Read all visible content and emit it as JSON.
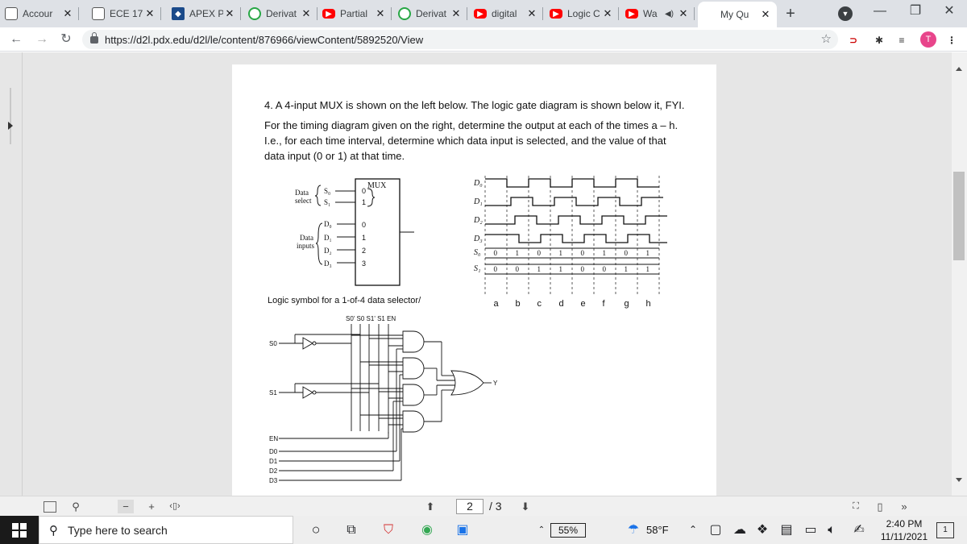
{
  "tabs": [
    {
      "label": "Accour",
      "icon": "d2l-icon"
    },
    {
      "label": "ECE 17",
      "icon": "d2l-icon"
    },
    {
      "label": "APEX P",
      "icon": "apex-icon"
    },
    {
      "label": "Derivat",
      "icon": "chegg-icon"
    },
    {
      "label": "Partial",
      "icon": "youtube-icon"
    },
    {
      "label": "Derivat",
      "icon": "chegg-icon"
    },
    {
      "label": "digital",
      "icon": "youtube-icon"
    },
    {
      "label": "Logic C",
      "icon": "youtube-icon"
    },
    {
      "label": "Wa",
      "icon": "youtube-icon"
    },
    {
      "label": "My Qu",
      "icon": "bartleby-icon"
    }
  ],
  "address_bar": {
    "url": "https://d2l.pdx.edu/d2l/le/content/876966/viewContent/5892520/View"
  },
  "profile": {
    "initial": "T",
    "color": "#e8458b"
  },
  "question": {
    "line1": "4. A 4-input MUX is shown on the left below.  The logic gate diagram is shown below it, FYI.",
    "line2": "For the timing diagram given on the right, determine the output at each of the times a – h.",
    "line3": "I.e., for each time interval, determine which data input is selected, and the value of that",
    "line4": "data input (0 or 1) at that time."
  },
  "mux": {
    "title": "MUX",
    "select_label_1": "Data",
    "select_label_2": "select",
    "select_lines": [
      "S₀",
      "S₁"
    ],
    "select_pins": [
      "0",
      "1"
    ],
    "input_label_1": "Data",
    "input_label_2": "inputs",
    "data_lines": [
      "D₀",
      "D₁",
      "D₂",
      "D₃"
    ],
    "data_pins": [
      "0",
      "1",
      "2",
      "3"
    ],
    "caption": "Logic symbol for a 1-of-4 data selector/"
  },
  "timing": {
    "signals": [
      "D₀",
      "D₁",
      "D₂",
      "D₃",
      "S₀",
      "S₁"
    ],
    "s0_values": [
      "0",
      "1",
      "0",
      "1",
      "0",
      "1",
      "0",
      "1"
    ],
    "s1_values": [
      "0",
      "0",
      "1",
      "1",
      "0",
      "0",
      "1",
      "1"
    ],
    "times": [
      "a",
      "b",
      "c",
      "d",
      "e",
      "f",
      "g",
      "h"
    ]
  },
  "gates": {
    "top_labels": "S0' S0 S1' S1 EN",
    "inputs": [
      "S0",
      "S1",
      "EN",
      "D0",
      "D1",
      "D2",
      "D3"
    ],
    "output": "Y"
  },
  "pdf_bar": {
    "page": "2",
    "total": "/ 3"
  },
  "taskbar": {
    "search_placeholder": "Type here to search",
    "battery": "55%",
    "temperature": "58°F",
    "time": "2:40 PM",
    "date": "11/11/2021",
    "notifications": "1"
  }
}
